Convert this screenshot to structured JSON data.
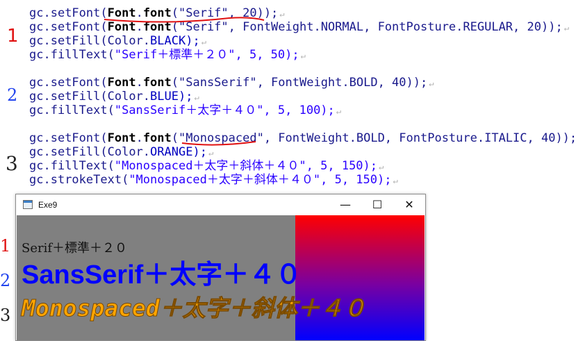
{
  "code": {
    "lines": [
      {
        "pre": "gc.",
        "fn": "setFont(",
        "cls": "Font",
        "dot": ".",
        "kw": "font",
        "rest": "(\"Serif\", 20));"
      },
      {
        "pre": "gc.",
        "fn": "setFont(",
        "cls": "Font",
        "dot": ".",
        "kw": "font",
        "rest": "(\"Serif\", FontWeight.NORMAL, FontPosture.REGULAR, 20));"
      },
      {
        "pre": "gc.",
        "fn": "setFill(",
        "cls": "Color",
        "dot": ".",
        "kw": "",
        "rest": "BLACK);"
      },
      {
        "pre": "gc.",
        "fn": "fillText(",
        "cls": "",
        "dot": "",
        "kw": "",
        "rest": "\"Serif＋標準＋２０\", 5, 50);"
      },
      {
        "pre": "gc.",
        "fn": "setFont(",
        "cls": "Font",
        "dot": ".",
        "kw": "font",
        "rest": "(\"SansSerif\", FontWeight.BOLD, 40));"
      },
      {
        "pre": "gc.",
        "fn": "setFill(",
        "cls": "Color",
        "dot": ".",
        "kw": "",
        "rest": "BLUE);"
      },
      {
        "pre": "gc.",
        "fn": "fillText(",
        "cls": "",
        "dot": "",
        "kw": "",
        "rest": "\"SansSerif＋太字＋４０\", 5, 100);"
      },
      {
        "pre": "gc.",
        "fn": "setFont(",
        "cls": "Font",
        "dot": ".",
        "kw": "font",
        "rest": "(\"Monospaced\", FontWeight.BOLD, FontPosture.ITALIC, 40));"
      },
      {
        "pre": "gc.",
        "fn": "setFill(",
        "cls": "Color",
        "dot": ".",
        "kw": "",
        "rest": "ORANGE);"
      },
      {
        "pre": "gc.",
        "fn": "fillText(",
        "cls": "",
        "dot": "",
        "kw": "",
        "rest": "\"Monospaced＋太字＋斜体＋４０\", 5, 150);"
      },
      {
        "pre": "gc.",
        "fn": "strokeText(",
        "cls": "",
        "dot": "",
        "kw": "",
        "rest": "\"Monospaced＋太字＋斜体＋４０\", 5, 150);"
      }
    ],
    "return_mark": "↵"
  },
  "annotations": {
    "code_markers": [
      "1",
      "2",
      "3"
    ],
    "window_markers": [
      "1",
      "2",
      "3"
    ]
  },
  "window": {
    "title": "Exe9",
    "minimize_glyph": "—",
    "maximize_glyph": "☐",
    "close_glyph": "✕",
    "canvas_texts": {
      "serif": "Serif＋標準＋２０",
      "sansserif": "SansSerif＋太字＋４０",
      "monospaced": "Monospaced＋太字＋斜体＋４０"
    }
  },
  "colors": {
    "editor_text": "#1a1a8c",
    "canvas_bg": "#808080",
    "gradient_top": "#ff0000",
    "gradient_bottom": "#0000ff",
    "blue_text": "#0000ff",
    "orange_text": "#ffa500",
    "annotation_red": "#e01010",
    "annotation_blue": "#2244ee"
  }
}
